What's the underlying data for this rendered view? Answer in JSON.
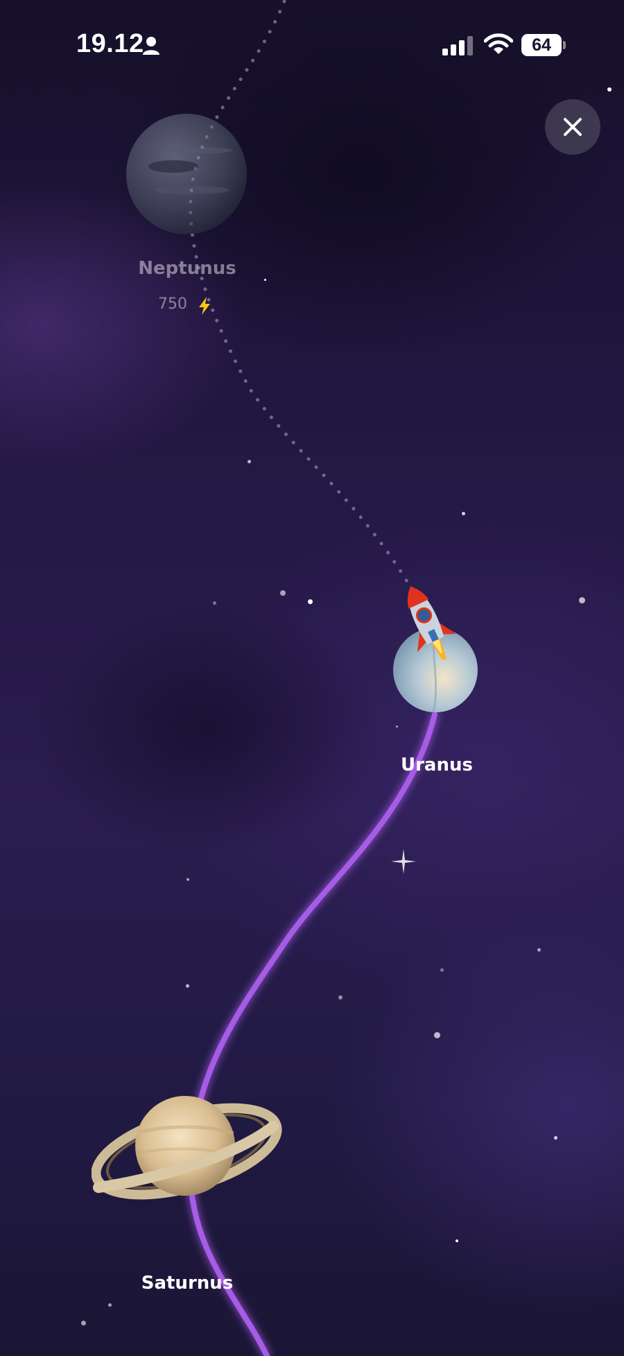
{
  "status_bar": {
    "time": "19.12",
    "battery": "64"
  },
  "icons": {
    "person": "person-icon",
    "signal": "cellular-signal-icon",
    "wifi": "wifi-icon",
    "close": "close-icon",
    "bolt": "lightning-bolt-icon",
    "rocket": "rocket-icon"
  },
  "planets": {
    "neptunus": {
      "label": "Neptunus",
      "cost": "750"
    },
    "uranus": {
      "label": "Uranus"
    },
    "saturnus": {
      "label": "Saturnus"
    }
  },
  "colors": {
    "path_active": "#a65be6",
    "path_locked": "#8a80a8",
    "background": "#241845"
  }
}
